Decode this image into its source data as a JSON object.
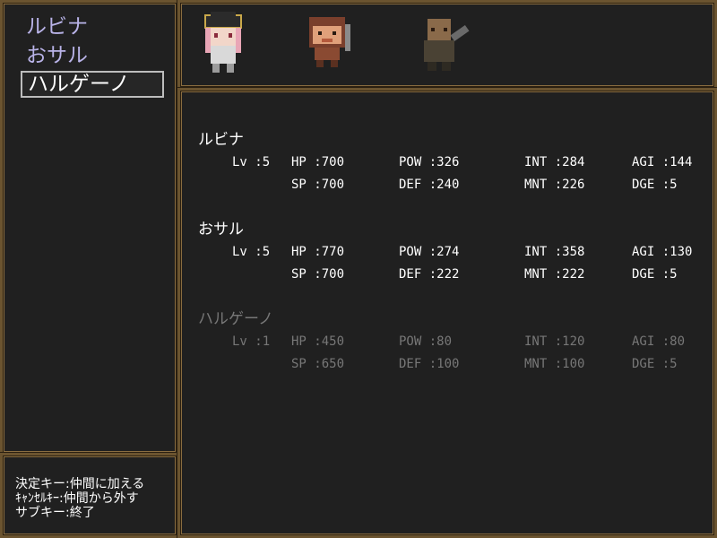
{
  "party": {
    "members": [
      "ルビナ",
      "おサル",
      "ハルゲーノ"
    ],
    "selected_index": 2
  },
  "help": {
    "line1": "決定キー:仲間に加える",
    "line2": "ｷｬﾝｾﾙｷｰ:仲間から外す",
    "line3": "サブキー:終了"
  },
  "stats": [
    {
      "name": "ルビナ",
      "lv": "Lv :5",
      "hp": "HP :700",
      "pow": "POW :326",
      "int": "INT :284",
      "agi": "AGI :144",
      "sp": "SP :700",
      "def": "DEF :240",
      "mnt": "MNT :226",
      "dge": "DGE :5"
    },
    {
      "name": "おサル",
      "lv": "Lv :5",
      "hp": "HP :770",
      "pow": "POW :274",
      "int": "INT :358",
      "agi": "AGI :130",
      "sp": "SP :700",
      "def": "DEF :222",
      "mnt": "MNT :222",
      "dge": "DGE :5"
    },
    {
      "name": "ハルゲーノ",
      "lv": "Lv :1",
      "hp": "HP :450",
      "pow": "POW :80",
      "int": "INT :120",
      "agi": "AGI :80",
      "sp": "SP :650",
      "def": "DEF :100",
      "mnt": "MNT :100",
      "dge": "DGE :5"
    }
  ],
  "colors": {
    "frame": "#6b5430",
    "menu_text": "#b9b3e8",
    "inactive_text": "#777777"
  }
}
